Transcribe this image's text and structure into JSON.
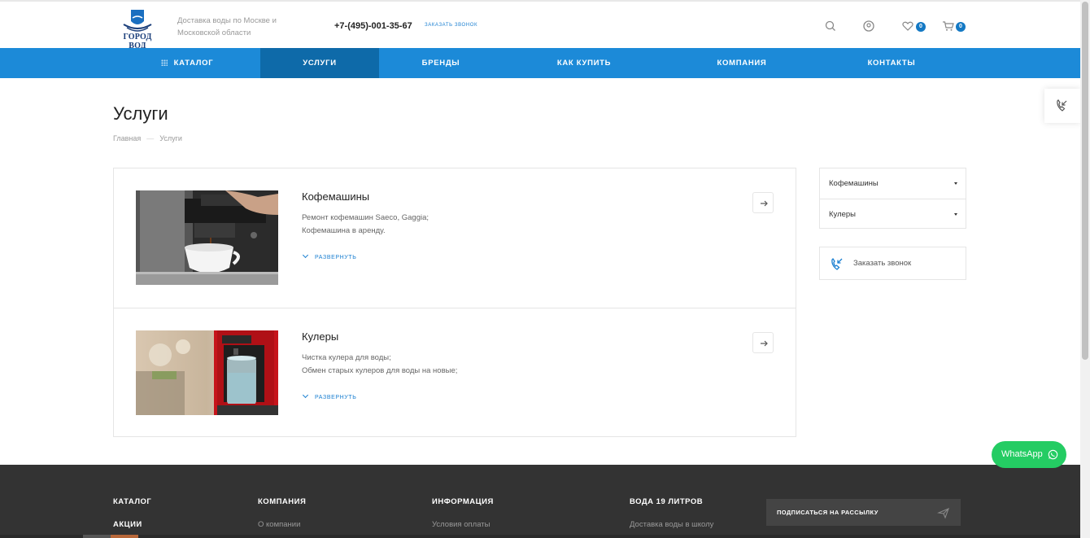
{
  "header": {
    "logo_text": "ГОРОД ВОД",
    "tagline": "Доставка воды по Москве и Московской области",
    "phone": "+7-(495)-001-35-67",
    "callback_link": "ЗАКАЗАТЬ ЗВОНОК",
    "favorites_count": "0",
    "cart_count": "0"
  },
  "nav": {
    "items": [
      {
        "label": "КАТАЛОГ"
      },
      {
        "label": "УСЛУГИ",
        "active": true
      },
      {
        "label": "БРЕНДЫ"
      },
      {
        "label": "КАК КУПИТЬ"
      },
      {
        "label": "КОМПАНИЯ"
      },
      {
        "label": "КОНТАКТЫ"
      }
    ]
  },
  "page": {
    "title": "Услуги",
    "breadcrumb": [
      "Главная",
      "Услуги"
    ]
  },
  "services": [
    {
      "name": "Кофемашины",
      "desc_line1": "Ремонт кофемашин Saeco, Gaggia;",
      "desc_line2": "Кофемашина в аренду.",
      "expand": "РАЗВЕРНУТЬ"
    },
    {
      "name": "Кулеры",
      "desc_line1": "Чистка кулера для воды;",
      "desc_line2": "Обмен старых кулеров для воды на новые;",
      "expand": "РАЗВЕРНУТЬ"
    }
  ],
  "sidebar": {
    "items": [
      {
        "label": "Кофемашины"
      },
      {
        "label": "Кулеры"
      }
    ],
    "callback": "Заказать звонок"
  },
  "whatsapp": "WhatsApp",
  "footer": {
    "columns": [
      {
        "title": "КАТАЛОГ",
        "link": "АКЦИИ"
      },
      {
        "title": "КОМПАНИЯ",
        "link": "О компании"
      },
      {
        "title": "ИНФОРМАЦИЯ",
        "link": "Условия оплаты"
      },
      {
        "title": "ВОДА 19 ЛИТРОВ",
        "link": "Доставка воды в школу"
      }
    ],
    "subscribe": "ПОДПИСАТЬСЯ НА РАССЫЛКУ"
  },
  "colors": {
    "nav_bg": "#1c8ad8",
    "nav_active": "#0e6aa9",
    "accent": "#1a7fd1",
    "footer_bg": "#333333",
    "whatsapp": "#24cc63"
  }
}
